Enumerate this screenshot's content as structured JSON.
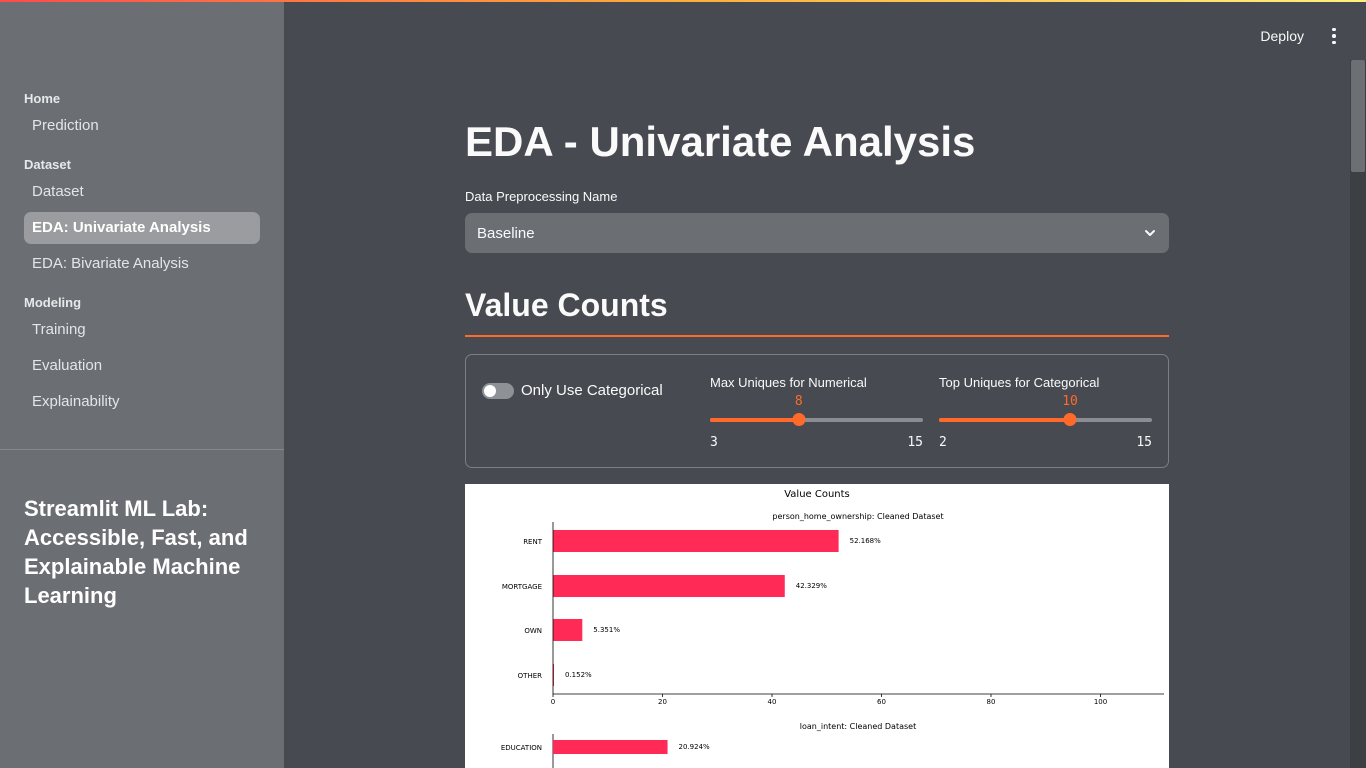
{
  "sidebar": {
    "sections": [
      {
        "label": "Home",
        "items": [
          "Prediction"
        ]
      },
      {
        "label": "Dataset",
        "items": [
          "Dataset",
          "EDA: Univariate Analysis",
          "EDA: Bivariate Analysis"
        ]
      },
      {
        "label": "Modeling",
        "items": [
          "Training",
          "Evaluation",
          "Explainability"
        ]
      }
    ],
    "active_item": "EDA: Univariate Analysis",
    "app_title": "Streamlit ML Lab: Accessible, Fast, and Explainable Machine Learning"
  },
  "header": {
    "deploy_label": "Deploy",
    "menu_icon": "kebab-menu-icon"
  },
  "main": {
    "page_title": "EDA - Univariate Analysis",
    "select": {
      "label": "Data Preprocessing Name",
      "value": "Baseline",
      "icon": "chevron-down-icon"
    },
    "section_title": "Value Counts",
    "controls": {
      "toggle": {
        "label": "Only Use Categorical",
        "on": false
      },
      "slider_numerical": {
        "label": "Max Uniques for Numerical",
        "value": 8,
        "min": 3,
        "max": 15
      },
      "slider_categorical": {
        "label": "Top Uniques for Categorical",
        "value": 10,
        "min": 2,
        "max": 15
      }
    }
  },
  "colors": {
    "accent": "#ff6a2b",
    "bar": "#ff2a55",
    "sidebar_bg": "#6b6e73",
    "main_bg": "#474a50"
  },
  "chart_data": {
    "type": "bar",
    "orientation": "horizontal",
    "title": "Value Counts",
    "subplots": [
      {
        "title": "person_home_ownership: Cleaned Dataset",
        "categories": [
          "RENT",
          "MORTGAGE",
          "OWN",
          "OTHER"
        ],
        "values": [
          52.168,
          42.329,
          5.351,
          0.152
        ],
        "labels": [
          "52.168%",
          "42.329%",
          "5.351%",
          "0.152%"
        ],
        "xticks": [
          0,
          20,
          40,
          60,
          80,
          100
        ],
        "xlim": [
          0,
          112
        ]
      },
      {
        "title": "loan_intent: Cleaned Dataset",
        "categories": [
          "EDUCATION"
        ],
        "values": [
          20.924
        ],
        "labels": [
          "20.924%"
        ]
      }
    ]
  }
}
